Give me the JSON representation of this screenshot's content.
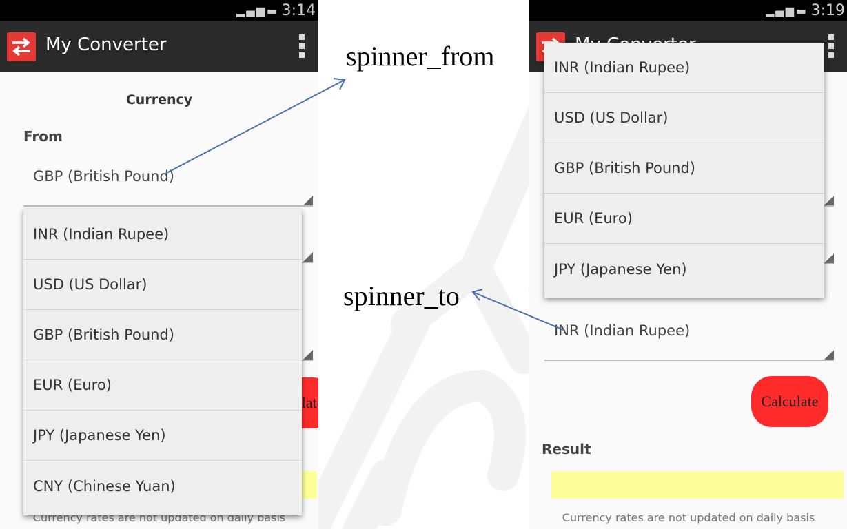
{
  "left_phone": {
    "status": {
      "time": "3:14"
    },
    "app_title": "My Converter",
    "section_title": "Currency",
    "from_label": "From",
    "from_value": "GBP (British Pound)",
    "calculate_label": "Calculate",
    "dropdown_items": [
      "INR (Indian Rupee)",
      "USD (US Dollar)",
      "GBP (British Pound)",
      "EUR (Euro)",
      "JPY (Japanese Yen)",
      "CNY (Chinese Yuan)"
    ],
    "footnote": "Currency rates are not updated on daily basis"
  },
  "right_phone": {
    "status": {
      "time": "3:19"
    },
    "app_title": "My Converter",
    "to_value": "INR (Indian Rupee)",
    "calculate_label": "Calculate",
    "result_label": "Result",
    "dropdown_items": [
      "INR (Indian Rupee)",
      "USD (US Dollar)",
      "GBP (British Pound)",
      "EUR (Euro)",
      "JPY (Japanese Yen)"
    ],
    "footnote": "Currency rates are not updated on daily basis"
  },
  "annotations": {
    "spinner_from": "spinner_from",
    "spinner_to": "spinner_to"
  },
  "colors": {
    "action_bar": "#2a2a2a",
    "app_icon": "#e53935",
    "calculate_button": "#ff2b2b",
    "result_box": "#ffff99",
    "arrow": "#4a72b0"
  },
  "icons": {
    "app": "swap-arrows-icon",
    "overflow": "overflow-menu-icon",
    "signal": "signal-icon",
    "battery": "battery-icon"
  }
}
